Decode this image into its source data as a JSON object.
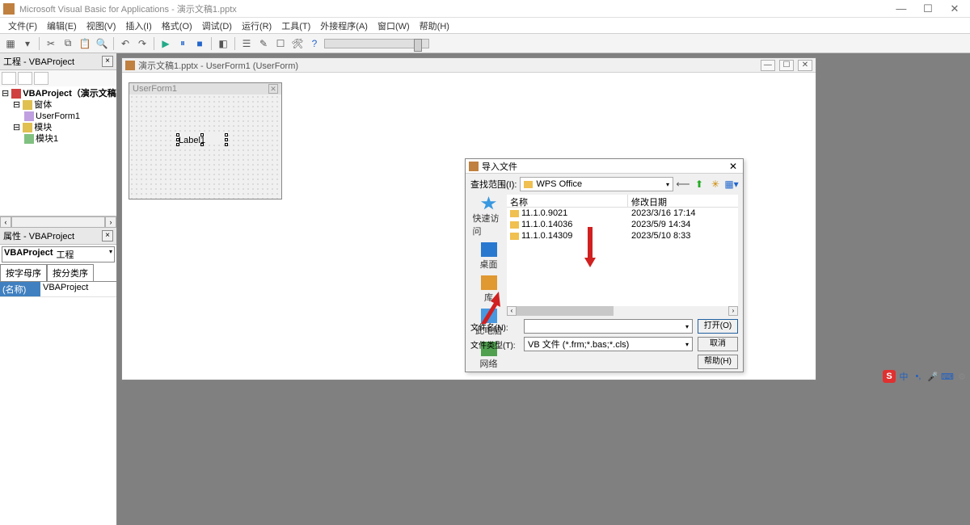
{
  "app": {
    "title": "Microsoft Visual Basic for Applications - 演示文稿1.pptx",
    "win_min": "—",
    "win_max": "☐",
    "win_close": "✕"
  },
  "menus": {
    "file": "文件(F)",
    "edit": "编辑(E)",
    "view": "视图(V)",
    "insert": "插入(I)",
    "format": "格式(O)",
    "debug": "调试(D)",
    "run": "运行(R)",
    "tools": "工具(T)",
    "addins": "外接程序(A)",
    "window": "窗口(W)",
    "help": "帮助(H)"
  },
  "project": {
    "panel_title": "工程 - VBAProject",
    "root": "VBAProject（演示文稿",
    "forms_folder": "窗体",
    "form1": "UserForm1",
    "modules_folder": "模块",
    "module1": "模块1"
  },
  "properties": {
    "panel_title": "属性 - VBAProject",
    "combo_name": "VBAProject",
    "combo_type": "工程",
    "tab_alpha": "按字母序",
    "tab_cat": "按分类序",
    "name_key": "(名称)",
    "name_val": "VBAProject"
  },
  "mdi": {
    "child_title": "演示文稿1.pptx - UserForm1 (UserForm)",
    "form_title": "UserForm1",
    "label_text": "Label1"
  },
  "dialog": {
    "title": "导入文件",
    "look_in_label": "查找范围(I):",
    "look_in_value": "WPS Office",
    "col_name": "名称",
    "col_date": "修改日期",
    "files": [
      {
        "name": "11.1.0.9021",
        "date": "2023/3/16 17:14"
      },
      {
        "name": "11.1.0.14036",
        "date": "2023/5/9 14:34"
      },
      {
        "name": "11.1.0.14309",
        "date": "2023/5/10 8:33"
      }
    ],
    "places": {
      "quick": "快速访问",
      "desktop": "桌面",
      "library": "库",
      "thispc": "此电脑",
      "network": "网络"
    },
    "filename_label": "文件名(N):",
    "filetype_label": "文件类型(T):",
    "filetype_value": "VB 文件 (*.frm;*.bas;*.cls)",
    "open_btn": "打开(O)",
    "cancel_btn": "取消",
    "help_btn": "帮助(H)"
  },
  "ime": {
    "s": "S",
    "cn": "中",
    "punct": "•,",
    "mic": "🎤",
    "kb": "⌨",
    "gear": "⚙"
  }
}
